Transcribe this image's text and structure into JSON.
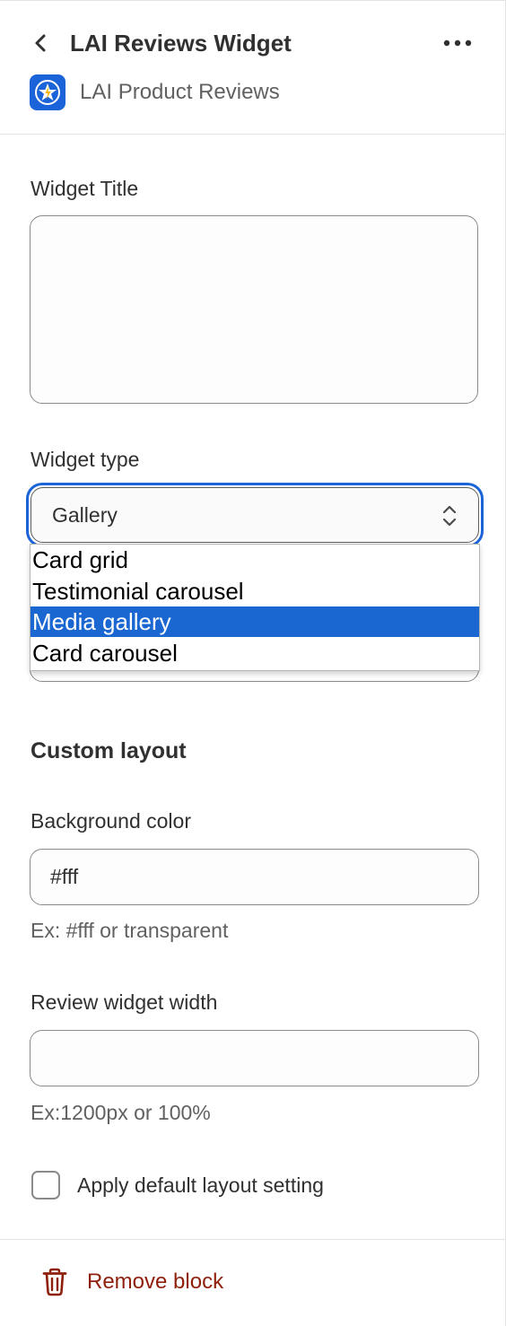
{
  "header": {
    "back_label": "Back",
    "title": "LAI Reviews Widget",
    "more_label": "More actions",
    "app_name": "LAI Product Reviews"
  },
  "widget_title": {
    "label": "Widget Title",
    "value": ""
  },
  "widget_type": {
    "label": "Widget type",
    "selected": "Gallery",
    "options": [
      "Card grid",
      "Testimonial carousel",
      "Media gallery",
      "Card carousel"
    ],
    "highlighted_option": "Media gallery"
  },
  "custom_layout": {
    "heading": "Custom layout",
    "background_color": {
      "label": "Background color",
      "value": "#fff",
      "help": "Ex: #fff or transparent"
    },
    "review_widget_width": {
      "label": "Review widget width",
      "value": "",
      "help": "Ex:1200px or 100%"
    },
    "apply_default": {
      "label": "Apply default layout setting",
      "checked": false
    }
  },
  "footer": {
    "remove_label": "Remove block"
  },
  "colors": {
    "accent": "#1a63d8",
    "text": "#303030",
    "subdued": "#616161",
    "critical": "#8e1f0b"
  }
}
